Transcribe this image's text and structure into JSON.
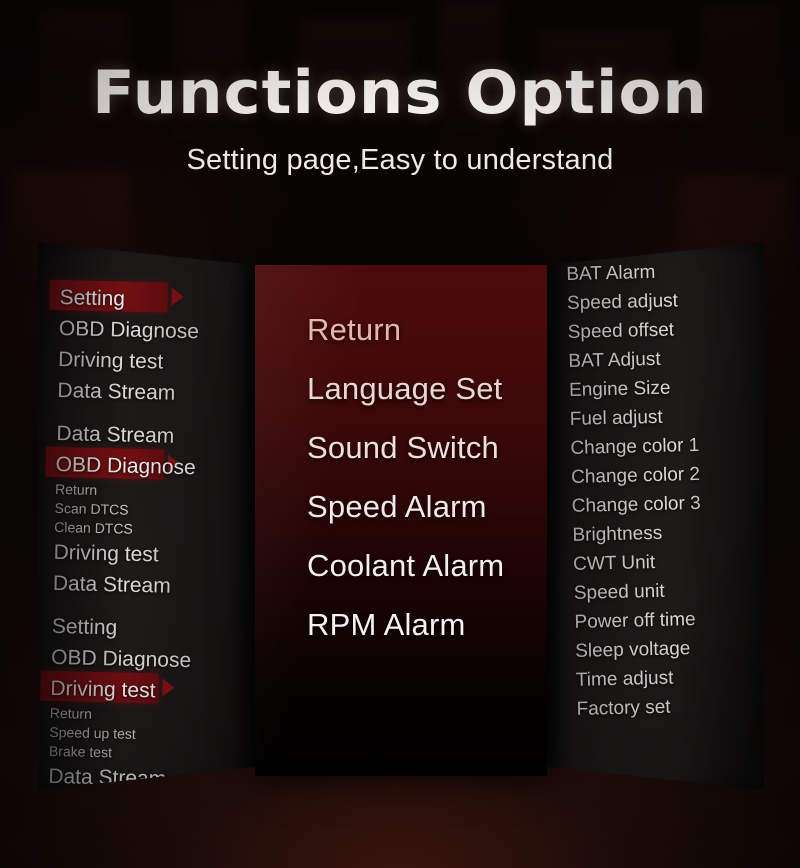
{
  "header": {
    "title_part1": "Functions",
    "title_part2": "Option",
    "subtitle": "Setting page,Easy to understand"
  },
  "colors": {
    "highlight_red": "#8b1116",
    "center_panel_top": "#4c0b0b",
    "center_panel_bottom": "#000000",
    "panel_surface": "#201d1c",
    "text_primary": "#eceae8"
  },
  "left_panel": {
    "name": "menu-tree-left",
    "items": [
      {
        "label": "Setting",
        "size": "big",
        "highlight": true,
        "arrow": true,
        "spacer_before": false
      },
      {
        "label": "OBD Diagnose",
        "size": "big",
        "highlight": false,
        "arrow": false,
        "spacer_before": false
      },
      {
        "label": "Driving test",
        "size": "big",
        "highlight": false,
        "arrow": false,
        "spacer_before": false
      },
      {
        "label": "Data Stream",
        "size": "big",
        "highlight": false,
        "arrow": false,
        "spacer_before": false
      },
      {
        "label": "Data Stream",
        "size": "big",
        "highlight": false,
        "arrow": false,
        "spacer_before": true
      },
      {
        "label": "OBD Diagnose",
        "size": "big",
        "highlight": true,
        "arrow": true,
        "spacer_before": false
      },
      {
        "label": "Return",
        "size": "small",
        "highlight": false,
        "arrow": false,
        "spacer_before": false
      },
      {
        "label": "Scan DTCS",
        "size": "small",
        "highlight": false,
        "arrow": false,
        "spacer_before": false
      },
      {
        "label": "Clean DTCS",
        "size": "small",
        "highlight": false,
        "arrow": false,
        "spacer_before": false
      },
      {
        "label": "Driving test",
        "size": "big",
        "highlight": false,
        "arrow": false,
        "spacer_before": false
      },
      {
        "label": "Data Stream",
        "size": "big",
        "highlight": false,
        "arrow": false,
        "spacer_before": false
      },
      {
        "label": "Setting",
        "size": "big",
        "highlight": false,
        "arrow": false,
        "spacer_before": true
      },
      {
        "label": "OBD Diagnose",
        "size": "big",
        "highlight": false,
        "arrow": false,
        "spacer_before": false
      },
      {
        "label": "Driving test",
        "size": "big",
        "highlight": true,
        "arrow": true,
        "spacer_before": false
      },
      {
        "label": "Return",
        "size": "small",
        "highlight": false,
        "arrow": false,
        "spacer_before": false
      },
      {
        "label": "Speed up test",
        "size": "small",
        "highlight": false,
        "arrow": false,
        "spacer_before": false
      },
      {
        "label": "Brake test",
        "size": "small",
        "highlight": false,
        "arrow": false,
        "spacer_before": false
      },
      {
        "label": "Data Stream",
        "size": "big",
        "highlight": false,
        "arrow": false,
        "spacer_before": false
      }
    ]
  },
  "center_panel": {
    "name": "settings-menu-center",
    "items": [
      {
        "label": "Return",
        "color": "#e8b4ae"
      },
      {
        "label": "Language Set",
        "color": "#ead6d2"
      },
      {
        "label": "Sound Switch",
        "color": "#eedfdc"
      },
      {
        "label": "Speed Alarm",
        "color": "#f1e9e7"
      },
      {
        "label": "Coolant Alarm",
        "color": "#f3efee"
      },
      {
        "label": "RPM Alarm",
        "color": "#f6f3f2"
      }
    ]
  },
  "right_panel": {
    "name": "settings-list-right",
    "items": [
      "BAT Alarm",
      "Speed adjust",
      "Speed offset",
      "BAT Adjust",
      "Engine Size",
      "Fuel adjust",
      "Change color 1",
      "Change color 2",
      "Change color 3",
      "Brightness",
      "CWT Unit",
      "Speed unit",
      "Power off time",
      "Sleep voltage",
      "Time adjust",
      "Factory set"
    ]
  }
}
